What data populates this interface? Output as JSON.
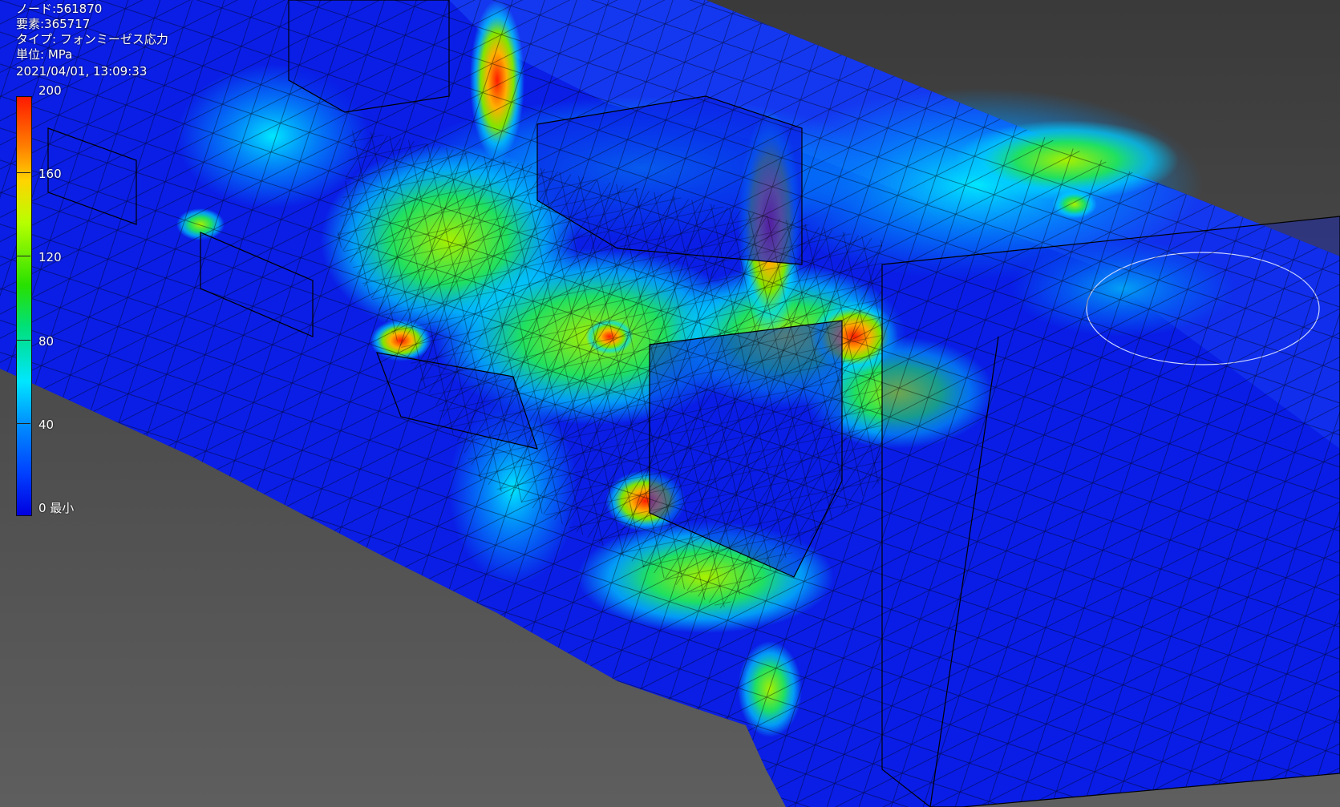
{
  "info": {
    "nodes": "ノード:561870",
    "elements": "要素:365717",
    "type": "タイプ: フォンミーゼス応力",
    "unit": "単位: MPa",
    "timestamp": "2021/04/01, 13:09:33"
  },
  "legend": {
    "labels": [
      "200",
      "160",
      "120",
      "80",
      "40",
      "0 最小"
    ],
    "values": [
      200,
      160,
      120,
      80,
      40,
      0
    ],
    "color_scale": [
      "#ff1a00",
      "#ff8000",
      "#ffd400",
      "#b8ff00",
      "#28e000",
      "#00e07a",
      "#00e6ff",
      "#0090ff",
      "#0040ff",
      "#0000e0"
    ]
  },
  "colors": {
    "background_top": "#3a3a3a",
    "background_bottom": "#5e5e5e",
    "low_stress": "#0a1ee6",
    "high_stress": "#ff2000"
  }
}
